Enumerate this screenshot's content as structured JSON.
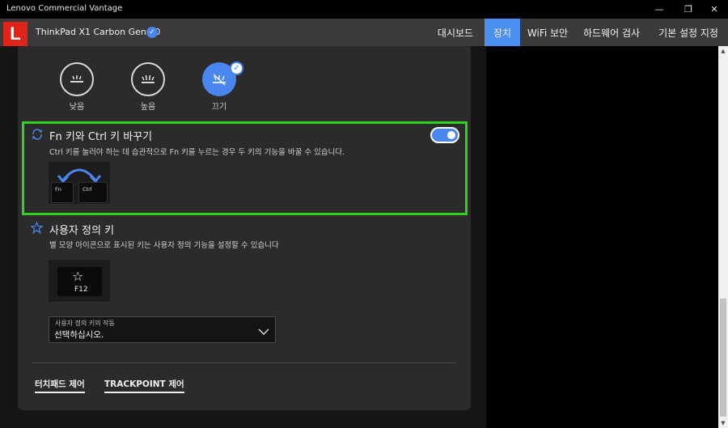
{
  "window": {
    "title": "Lenovo Commercial Vantage",
    "controls": {
      "minimize": "—",
      "restore": "❐",
      "close": "✕"
    }
  },
  "header": {
    "logo_letter": "L",
    "device_name": "ThinkPad X1 Carbon Gen 10",
    "verified_icon": "✓",
    "nav": [
      "대시보드",
      "장치",
      "WiFi 보안",
      "하드웨어 검사",
      "기본 설정 지정"
    ],
    "active_nav": "장치",
    "accent_color": "#4a90f0"
  },
  "backlight": {
    "options": [
      {
        "label": "낮음",
        "icon": "keyboard-backlight-low-icon"
      },
      {
        "label": "높음",
        "icon": "keyboard-backlight-high-icon"
      },
      {
        "label": "끄기",
        "icon": "keyboard-backlight-off-icon",
        "selected": true
      }
    ],
    "check": "✓"
  },
  "fn_ctrl_swap": {
    "title": "Fn 키와 Ctrl 키 바꾸기",
    "description": "Ctrl 키를 눌러야 하는 데 습관적으로 Fn 키를 누르는 경우 두 키의 기능을 바꿀 수 있습니다.",
    "toggle_on": true,
    "key_left": "Fn",
    "key_right": "Ctrl",
    "highlight_color": "#2ed41e"
  },
  "custom_key": {
    "title": "사용자 정의 키",
    "description": "별 모양 아이콘으로 표시된 키는 사용자 정의 기능을 설정할 수 있습니다",
    "key_label": "F12",
    "star": "☆",
    "select": {
      "label": "사용자 정의 키의 작동",
      "value": "선택하십시오."
    }
  },
  "bottom_links": [
    "터치패드 제어",
    "TRACKPOINT 제어"
  ],
  "scrollbar": {
    "up": "▲",
    "down": "▼"
  }
}
